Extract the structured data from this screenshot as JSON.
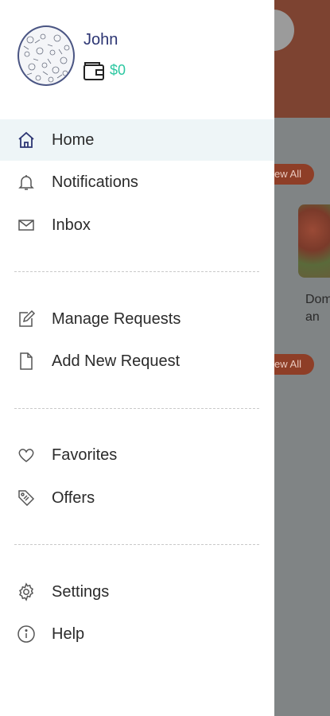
{
  "user": {
    "name": "John",
    "balance": "$0"
  },
  "background": {
    "view_all_1": "ew All",
    "view_all_2": "ew All",
    "partial_text_line1": "Dom",
    "partial_text_line2": "an"
  },
  "menu": {
    "home": "Home",
    "notifications": "Notifications",
    "inbox": "Inbox",
    "manage_requests": "Manage Requests",
    "add_new_request": "Add New Request",
    "favorites": "Favorites",
    "offers": "Offers",
    "settings": "Settings",
    "help": "Help"
  },
  "colors": {
    "active_bg": "#eef5f7",
    "accent_green": "#2cc7a1",
    "name_blue": "#2c3573",
    "header_dimmed": "#7d4331"
  }
}
